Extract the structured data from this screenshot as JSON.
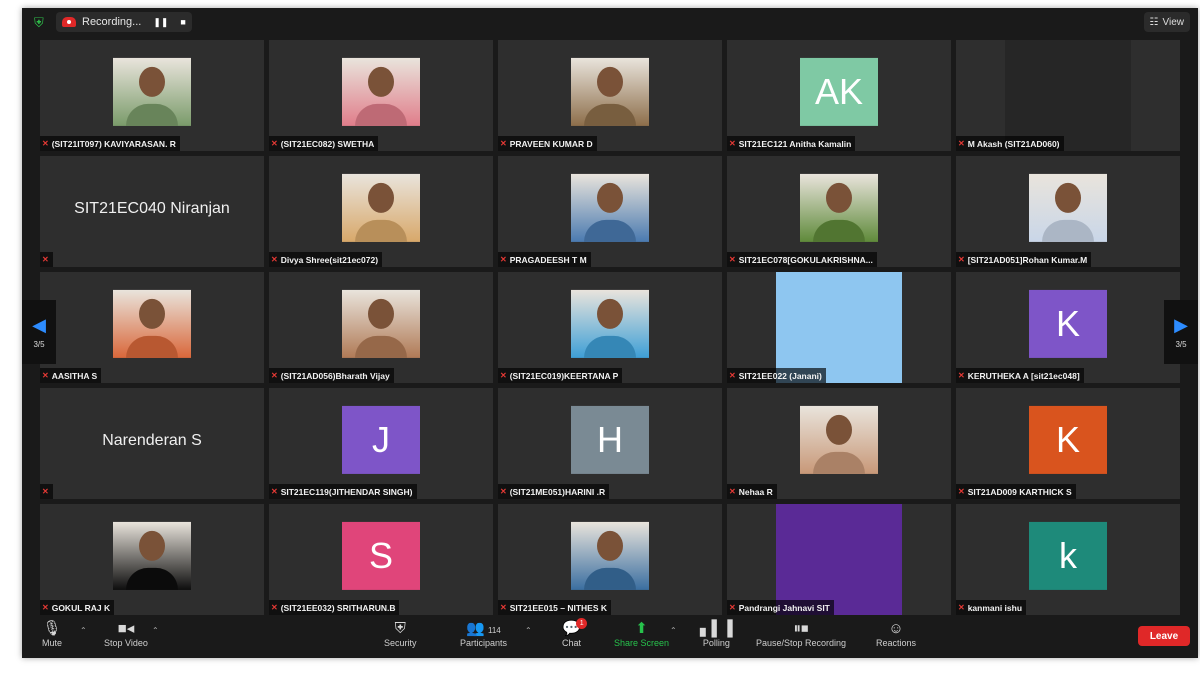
{
  "topbar": {
    "recording_label": "Recording...",
    "pause_glyph": "❚❚",
    "stop_glyph": "■",
    "view_label": "View"
  },
  "tiles": [
    {
      "label": "(SIT21IT097) KAVIYARASAN. R",
      "kind": "photo",
      "color": "#7a9b6a"
    },
    {
      "label": "(SIT21EC082) SWETHA",
      "kind": "photo",
      "color": "#e07d8a"
    },
    {
      "label": "PRAVEEN KUMAR D",
      "kind": "photo",
      "color": "#8d6e4a"
    },
    {
      "label": "SIT21EC121 Anitha Kamalin",
      "kind": "letter",
      "letter": "AK",
      "color": "#7fc9a4"
    },
    {
      "label": "M Akash (SIT21AD060)",
      "kind": "blank",
      "color": "#262626"
    },
    {
      "label": "",
      "kind": "name",
      "bigname": "SIT21EC040 Niranjan"
    },
    {
      "label": "Divya Shree(sit21ec072)",
      "kind": "photo",
      "color": "#d8a86a"
    },
    {
      "label": "PRAGADEESH T M",
      "kind": "photo",
      "color": "#4a7ab0"
    },
    {
      "label": "SIT21EC078[GOKULAKRISHNA...",
      "kind": "photo",
      "color": "#5f8a3a"
    },
    {
      "label": "[SIT21AD051]Rohan Kumar.M",
      "kind": "photo",
      "color": "#c9d6e8"
    },
    {
      "label": "AASITHA S",
      "kind": "photo",
      "color": "#d9673a"
    },
    {
      "label": "(SIT21AD056)Bharath Vijay",
      "kind": "photo",
      "color": "#b07a56"
    },
    {
      "label": "(SIT21EC019)KEERTANA P",
      "kind": "photo",
      "color": "#3e9fd6"
    },
    {
      "label": "SIT21EE022 (Janani)",
      "kind": "solid",
      "color": "#8ec6f0"
    },
    {
      "label": "KERUTHEKA A [sit21ec048]",
      "kind": "letter",
      "letter": "K",
      "color": "#7e55c8"
    },
    {
      "label": "",
      "kind": "name",
      "bigname": "Narenderan S"
    },
    {
      "label": "SIT21EC119(JITHENDAR SINGH)",
      "kind": "letter",
      "letter": "J",
      "color": "#7e55c8"
    },
    {
      "label": "(SIT21ME051)HARINI .R",
      "kind": "letter",
      "letter": "H",
      "color": "#7a8a94"
    },
    {
      "label": "Nehaa R",
      "kind": "photo",
      "color": "#c89878"
    },
    {
      "label": "SIT21AD009 KARTHICK S",
      "kind": "letter",
      "letter": "K",
      "color": "#d9541e"
    },
    {
      "label": "GOKUL RAJ K",
      "kind": "photo",
      "color": "#0d0d0d"
    },
    {
      "label": "(SIT21EE032) SRITHARUN.B",
      "kind": "letter",
      "letter": "S",
      "color": "#e0457a"
    },
    {
      "label": "SIT21EE015 – NITHES K",
      "kind": "photo",
      "color": "#3a6ea0"
    },
    {
      "label": "Pandrangi Jahnavi SIT",
      "kind": "solid",
      "color": "#5a2a96"
    },
    {
      "label": "kanmani ishu",
      "kind": "letter",
      "letter": "k",
      "color": "#1e8a7a"
    }
  ],
  "nav": {
    "left_page": "3/5",
    "right_page": "3/5"
  },
  "toolbar": {
    "mute": "Mute",
    "stop_video": "Stop Video",
    "security": "Security",
    "participants": "Participants",
    "participants_count": "114",
    "chat": "Chat",
    "chat_badge": "1",
    "share_screen": "Share Screen",
    "polling": "Polling",
    "recording": "Pause/Stop Recording",
    "reactions": "Reactions",
    "leave": "Leave"
  }
}
